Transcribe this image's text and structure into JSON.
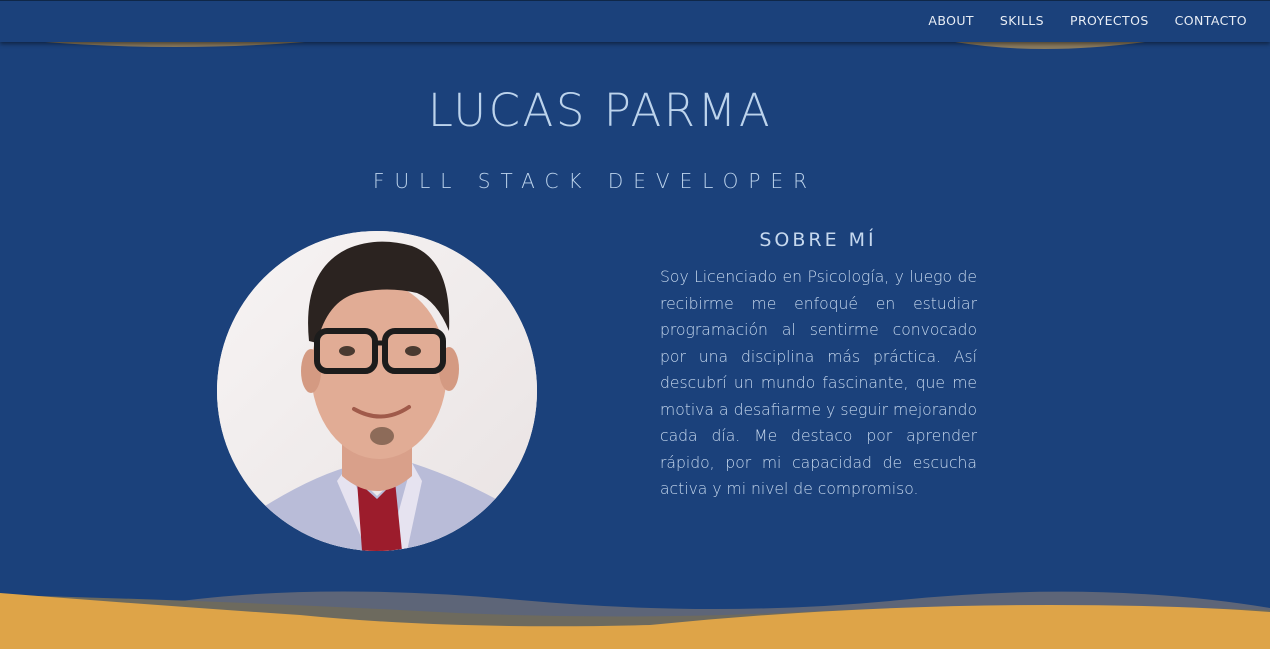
{
  "nav": {
    "items": [
      {
        "label": "ABOUT"
      },
      {
        "label": "SKILLS"
      },
      {
        "label": "PROYECTOS"
      },
      {
        "label": "CONTACTO"
      }
    ]
  },
  "hero": {
    "name": "LUCAS PARMA",
    "role": "FULL STACK DEVELOPER"
  },
  "about": {
    "title": "SOBRE MÍ",
    "text": "Soy Licenciado en Psicología, y luego de recibirme me enfoqué en estudiar programación al sentirme convocado por una disciplina más práctica. Así descubrí un mundo fascinante, que me motiva a desafiarme y seguir mejorando cada día. Me destaco por aprender rápido, por mi capacidad de escucha activa y mi nivel de compromiso."
  },
  "colors": {
    "background": "#1b417b",
    "text": "#bcd3ec",
    "accent_wave": "#dea448",
    "muted_wave": "#6d6a5e"
  }
}
